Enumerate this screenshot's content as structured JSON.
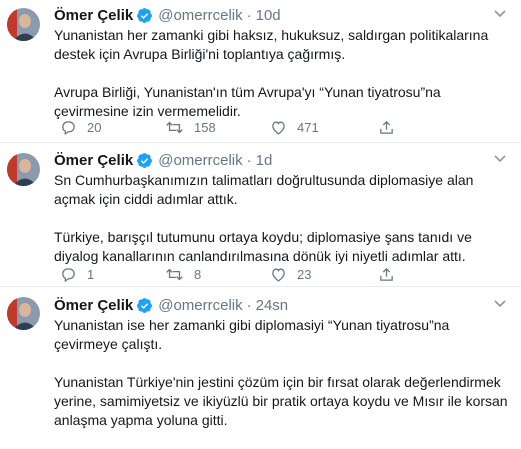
{
  "colors": {
    "accent": "#1da1f2",
    "muted": "#657786",
    "text": "#14171a",
    "divider": "#e6ecf0"
  },
  "tweets": [
    {
      "author": "Ömer Çelik",
      "handle": "@omerrcelik",
      "separator": "·",
      "time": "10d",
      "paragraphs": [
        "Yunanistan her zamanki gibi haksız, hukuksuz, saldırgan politikalarına destek için Avrupa Birliği'ni toplantıya çağırmış.",
        "Avrupa Birliği, Yunanistan'ın tüm Avrupa'yı “Yunan tiyatrosu”na çevirmesine izin vermemelidir."
      ],
      "replies": "20",
      "retweets": "158",
      "likes": "471",
      "icons": [
        "verified-badge-icon",
        "reply-icon",
        "retweet-icon",
        "like-icon",
        "share-icon",
        "caret-down-icon"
      ]
    },
    {
      "author": "Ömer Çelik",
      "handle": "@omerrcelik",
      "separator": "·",
      "time": "1d",
      "paragraphs": [
        "Sn Cumhurbaşkanımızın talimatları doğrultusunda diplomasiye alan açmak için ciddi adımlar attık.",
        "Türkiye, barışçıl tutumunu ortaya koydu; diplomasiye şans tanıdı ve diyalog kanallarının canlandırılmasına dönük iyi niyetli adımlar attı."
      ],
      "replies": "1",
      "retweets": "8",
      "likes": "23"
    },
    {
      "author": "Ömer Çelik",
      "handle": "@omerrcelik",
      "separator": "·",
      "time": "24sn",
      "paragraphs": [
        "Yunanistan ise her zamanki gibi diplomasiyi “Yunan tiyatrosu”na çevirmeye çalıştı.",
        "Yunanistan Türkiye'nin jestini çözüm için bir fırsat olarak değerlendirmek yerine, samimiyetsiz ve ikiyüzlü bir pratik ortaya koydu ve Mısır ile korsan anlaşma yapma yoluna gitti."
      ]
    }
  ]
}
